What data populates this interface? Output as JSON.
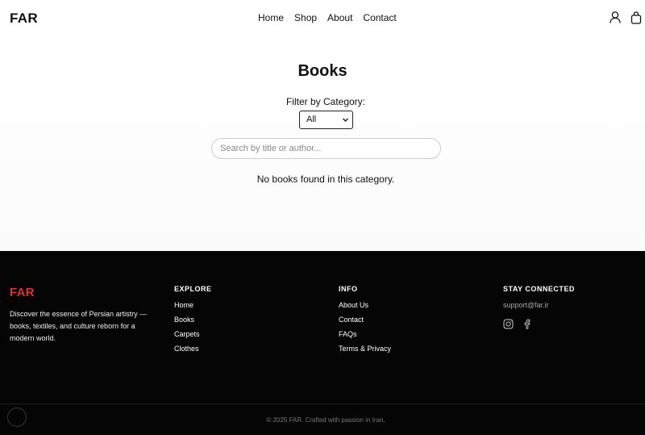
{
  "header": {
    "logo": "FAR",
    "nav": [
      "Home",
      "Shop",
      "About",
      "Contact"
    ],
    "icons": [
      "user-icon",
      "shopping-bag-icon"
    ]
  },
  "main": {
    "title": "Books",
    "filter_label": "Filter by Category:",
    "filter_value": "All",
    "search_placeholder": "Search by title or author...",
    "empty_message": "No books found in this category."
  },
  "footer": {
    "logo": "FAR",
    "description": "Discover the essence of Persian artistry — books, textiles, and culture reborn for a modern world.",
    "explore": {
      "heading": "EXPLORE",
      "links": [
        "Home",
        "Books",
        "Carpets",
        "Clothes"
      ]
    },
    "info": {
      "heading": "INFO",
      "links": [
        "About Us",
        "Contact",
        "FAQs",
        "Terms & Privacy"
      ]
    },
    "stay": {
      "heading": "STAY CONNECTED",
      "email": "support@far.ir",
      "icons": [
        "instagram-icon",
        "facebook-icon"
      ]
    },
    "copyright": "© 2025 FAR. Crafted with passion in Iran."
  },
  "colors": {
    "footer_bg": "#050505",
    "footer_logo": "#e0302a",
    "text": "#111111"
  }
}
